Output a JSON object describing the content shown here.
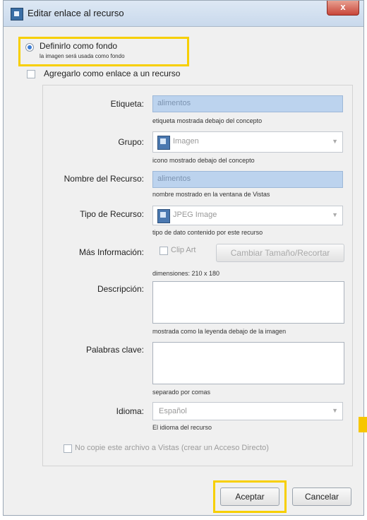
{
  "window": {
    "title": "Editar enlace al recurso",
    "close_label": "x"
  },
  "option_background": {
    "label": "Definirlo como fondo",
    "sublabel": "la imagen será usada como fondo",
    "selected": true
  },
  "option_link": {
    "label": "Agregarlo como enlace a un recurso",
    "selected": false
  },
  "form": {
    "etiqueta": {
      "label": "Etiqueta:",
      "value": "alimentos",
      "hint": "etiqueta mostrada debajo del concepto"
    },
    "grupo": {
      "label": "Grupo:",
      "value": "Imagen",
      "hint": "icono mostrado debajo del concepto",
      "icon": "image-icon"
    },
    "nombre": {
      "label": "Nombre del Recurso:",
      "value": "alimentos",
      "hint": "nombre mostrado en la ventana de Vistas"
    },
    "tipo": {
      "label": "Tipo de Recurso:",
      "value": "JPEG Image",
      "hint": "tipo de dato contenido por este recurso",
      "icon": "jpeg-icon"
    },
    "mas_info": {
      "label": "Más Información:",
      "clip_art_label": "Clip Art",
      "resize_button": "Cambiar Tamaño/Recortar",
      "hint": "dimensiones: 210 x 180"
    },
    "descripcion": {
      "label": "Descripción:",
      "value": "",
      "hint": "mostrada como la leyenda debajo de la imagen"
    },
    "palabras": {
      "label": "Palabras clave:",
      "value": "",
      "hint": "separado por comas"
    },
    "idioma": {
      "label": "Idioma:",
      "value": "Español",
      "hint": "El idioma del recurso"
    },
    "no_copiar": {
      "label": "No copie este archivo a Vistas (crear un Acceso Directo)"
    }
  },
  "buttons": {
    "accept": "Aceptar",
    "cancel": "Cancelar"
  },
  "colors": {
    "highlight": "#f7cf00",
    "field_blue": "#bcd3ee",
    "radio_accent": "#3a7bd5"
  }
}
